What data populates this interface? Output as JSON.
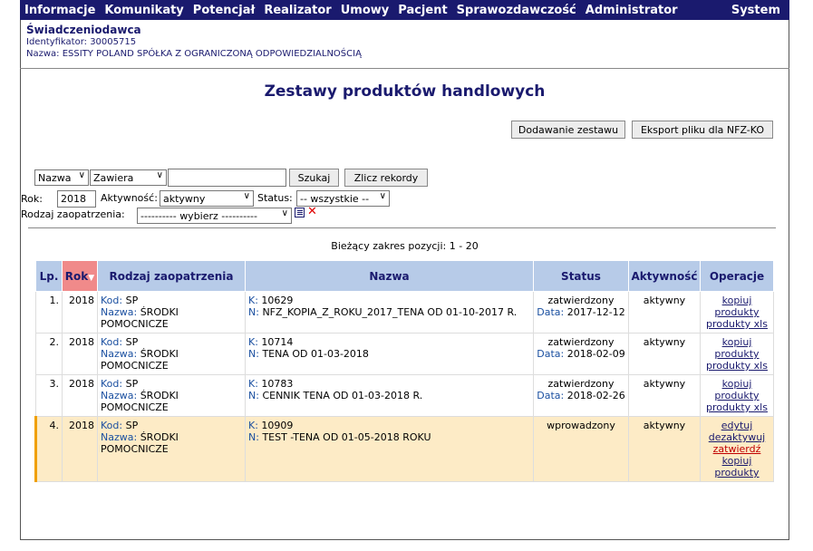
{
  "menu": {
    "items": [
      "Informacje",
      "Komunikaty",
      "Potencjał",
      "Realizator",
      "Umowy",
      "Pacjent",
      "Sprawozdawczość",
      "Administrator"
    ],
    "system": "System"
  },
  "provider": {
    "title": "Świadczeniodawca",
    "id_line": "Identyfikator: 30005715",
    "name_line": "Nazwa: ESSITY POLAND SPÓŁKA Z OGRANICZONĄ ODPOWIEDZIALNOŚCIĄ"
  },
  "page_title": "Zestawy produktów handlowych",
  "buttons": {
    "add_set": "Dodawanie zestawu",
    "export": "Eksport pliku dla NFZ-KO"
  },
  "filter": {
    "field": "Nazwa",
    "operator": "Zawiera",
    "text": "",
    "search": "Szukaj",
    "count": "Zlicz rekordy",
    "year_label": "Rok:",
    "year": "2018",
    "activity_label": "Aktywność:",
    "activity": "aktywny",
    "status_label": "Status:",
    "status": "-- wszystkie --",
    "supply_label": "Rodzaj zaopatrzenia:",
    "supply": "---------- wybierz ----------"
  },
  "range": "Bieżący zakres pozycji: 1 - 20",
  "table": {
    "headers": {
      "lp": "Lp.",
      "rok": "Rok",
      "rodzaj": "Rodzaj zaopatrzenia",
      "nazwa": "Nazwa",
      "status": "Status",
      "aktywnosc": "Aktywność",
      "operacje": "Operacje"
    },
    "labels": {
      "kod": "Kod:",
      "nazwa": "Nazwa:",
      "k": "K:",
      "n": "N:",
      "data": "Data:"
    },
    "rows": [
      {
        "lp": "1.",
        "rok": "2018",
        "kod": "SP",
        "nazwa": "ŚRODKI POMOCNICZE",
        "k": "10629",
        "n": "NFZ_KOPIA_Z_ROKU_2017_TENA OD 01-10-2017 R.",
        "status": "zatwierdzony",
        "data": "2017-12-12",
        "aktywnosc": "aktywny",
        "ops": [
          "kopiuj",
          "produkty",
          "produkty xls"
        ]
      },
      {
        "lp": "2.",
        "rok": "2018",
        "kod": "SP",
        "nazwa": "ŚRODKI POMOCNICZE",
        "k": "10714",
        "n": "TENA OD 01-03-2018",
        "status": "zatwierdzony",
        "data": "2018-02-09",
        "aktywnosc": "aktywny",
        "ops": [
          "kopiuj",
          "produkty",
          "produkty xls"
        ]
      },
      {
        "lp": "3.",
        "rok": "2018",
        "kod": "SP",
        "nazwa": "ŚRODKI POMOCNICZE",
        "k": "10783",
        "n": "CENNIK TENA OD 01-03-2018 R.",
        "status": "zatwierdzony",
        "data": "2018-02-26",
        "aktywnosc": "aktywny",
        "ops": [
          "kopiuj",
          "produkty",
          "produkty xls"
        ]
      },
      {
        "lp": "4.",
        "rok": "2018",
        "kod": "SP",
        "nazwa": "ŚRODKI POMOCNICZE",
        "k": "10909",
        "n": "TEST -TENA OD 01-05-2018 ROKU",
        "status": "wprowadzony",
        "data": "",
        "aktywnosc": "aktywny",
        "ops": [
          "edytuj",
          "dezaktywuj",
          "zatwierdź",
          "kopiuj",
          "produkty"
        ]
      }
    ]
  },
  "colors": {
    "navy": "#1a1a6e",
    "header_bg": "#b7cbe8",
    "sorted_header": "#f08a8a",
    "highlight_row": "#fdebc6",
    "danger_link": "#c00000"
  }
}
